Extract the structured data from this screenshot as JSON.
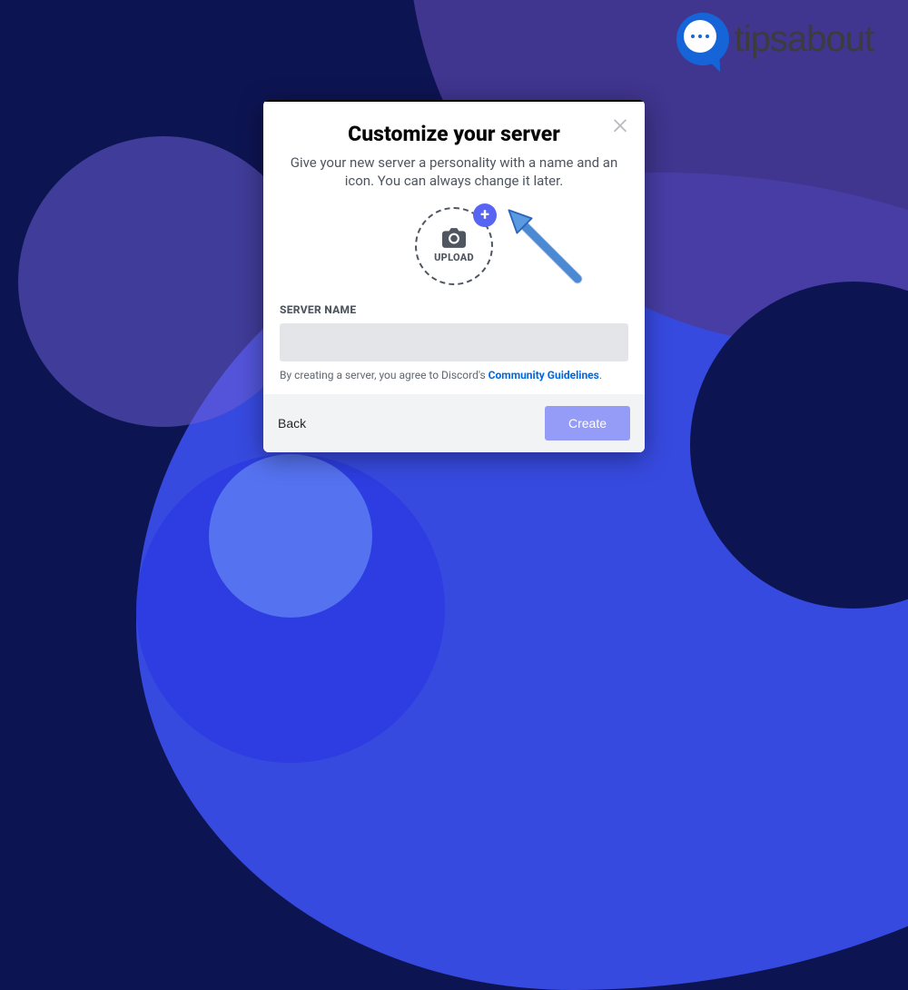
{
  "watermark": {
    "text": "tipsabout"
  },
  "modal": {
    "title": "Customize your server",
    "subtitle": "Give your new server a personality with a name and an icon. You can always change it later.",
    "upload_label": "UPLOAD",
    "server_name_label": "SERVER NAME",
    "server_name_value": "",
    "agreement_prefix": "By creating a server, you agree to Discord's ",
    "agreement_link": "Community Guidelines",
    "agreement_suffix": ".",
    "back_label": "Back",
    "create_label": "Create"
  },
  "colors": {
    "accent": "#5865f2",
    "link": "#0068e0"
  }
}
